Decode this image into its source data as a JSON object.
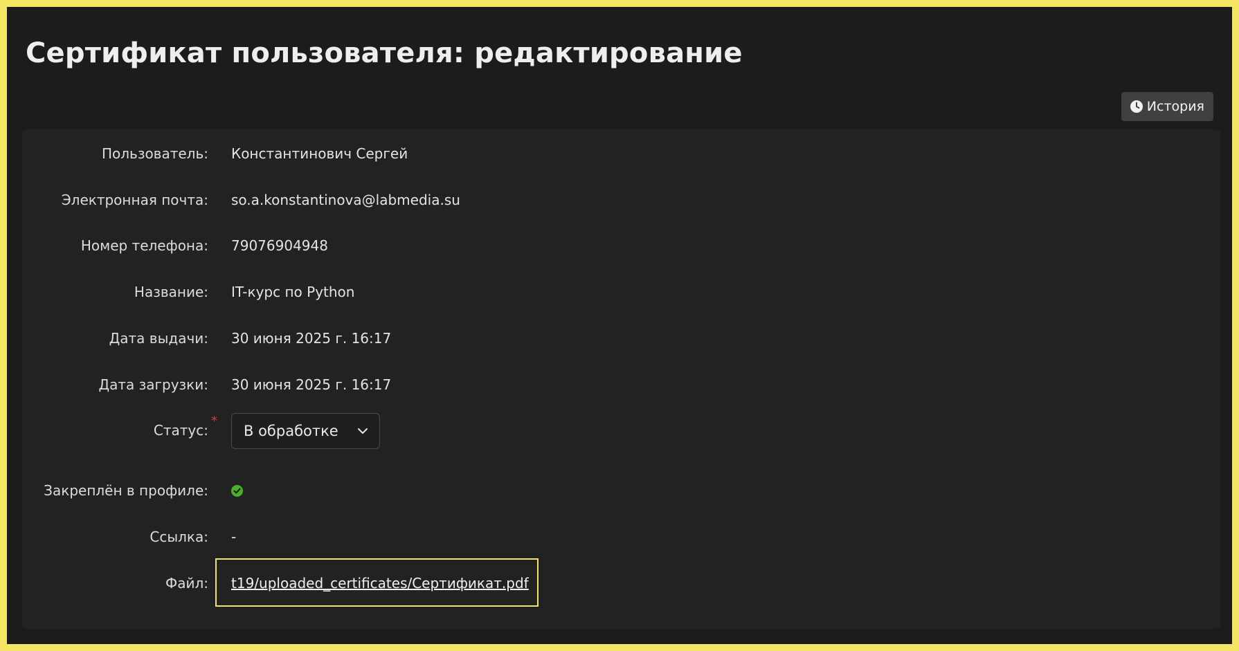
{
  "page": {
    "title": "Сертификат пользователя: редактирование"
  },
  "toolbar": {
    "history_label": "История"
  },
  "form": {
    "user": {
      "label": "Пользователь:",
      "value": "Константинович Сергей"
    },
    "email": {
      "label": "Электронная почта:",
      "value": "so.a.konstantinova@labmedia.su"
    },
    "phone": {
      "label": "Номер телефона:",
      "value": "79076904948"
    },
    "name": {
      "label": "Название:",
      "value": "IT-курс по Python"
    },
    "issue_date": {
      "label": "Дата выдачи:",
      "value": "30 июня 2025 г. 16:17"
    },
    "upload_date": {
      "label": "Дата загрузки:",
      "value": "30 июня 2025 г. 16:17"
    },
    "status": {
      "label": "Статус:",
      "required_mark": "*",
      "selected": "В обработке"
    },
    "pinned": {
      "label": "Закреплён в профиле:",
      "value": true
    },
    "link": {
      "label": "Ссылка:",
      "value": "-"
    },
    "file": {
      "label": "Файл:",
      "value": "t19/uploaded_certificates/Сертификат.pdf"
    }
  },
  "icons": {
    "history": "clock-icon",
    "status_dropdown": "chevron-down-icon",
    "pinned": "check-circle-icon"
  },
  "colors": {
    "highlight_border": "#f4e564",
    "check_green": "#4caf2a",
    "required_red": "#e03b3b"
  }
}
